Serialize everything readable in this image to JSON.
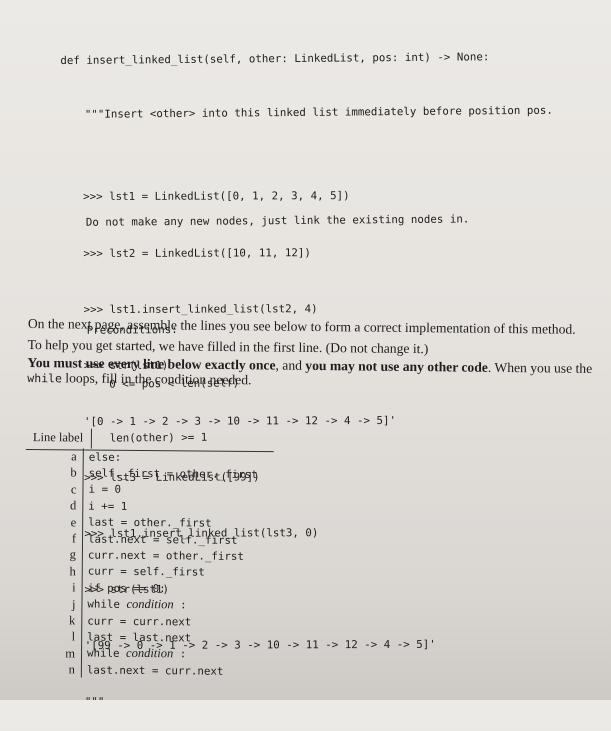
{
  "signature": {
    "def_line": "def insert_linked_list(self, other: LinkedList, pos: int) -> None:",
    "docstring_first": "\"\"\"Insert <other> into this linked list immediately before position pos.",
    "docstring_note": "Do not make any new nodes, just link the existing nodes in.",
    "preconditions_heading": "Preconditions:",
    "preconditions": [
      "0 <= pos < len(self)",
      "len(other) >= 1"
    ]
  },
  "doctest": [
    ">>> lst1 = LinkedList([0, 1, 2, 3, 4, 5])",
    ">>> lst2 = LinkedList([10, 11, 12])",
    ">>> lst1.insert_linked_list(lst2, 4)",
    ">>> str(lst1)",
    "'[0 -> 1 -> 2 -> 3 -> 10 -> 11 -> 12 -> 4 -> 5]'",
    ">>> lst3 = LinkedList([99])",
    ">>> lst1.insert_linked_list(lst3, 0)",
    ">>> str(lst1)",
    "'[99 -> 0 -> 1 -> 2 -> 3 -> 10 -> 11 -> 12 -> 4 -> 5]'",
    "\"\"\""
  ],
  "instructions": {
    "p1_line1": "On the next page, assemble the lines you see below to form a correct implementation of this method.",
    "p1_line2": "To help you get started, we have filled in the first line. (Do not change it.)",
    "p2_bold1": "You must use every line below exactly once",
    "p2_text1": ", and ",
    "p2_bold2": "you may not use any other code",
    "p2_text2": ". When you use the ",
    "p2_code": "while",
    "p2_text3": " loops, fill in the condition needed."
  },
  "table": {
    "header": "Line label",
    "rows": [
      {
        "label": "a",
        "code": "else:"
      },
      {
        "label": "b",
        "code": "self._first = other._first"
      },
      {
        "label": "c",
        "code": "i = 0"
      },
      {
        "label": "d",
        "code": "i += 1"
      },
      {
        "label": "e",
        "code": "last = other._first"
      },
      {
        "label": "f",
        "code": "last.next = self._first"
      },
      {
        "label": "g",
        "code": "curr.next = other._first"
      },
      {
        "label": "h",
        "code": "curr = self._first"
      },
      {
        "label": "i",
        "code": "if pos == 0:"
      },
      {
        "label": "j",
        "code": "while ",
        "italic": "condition",
        "suffix": " :"
      },
      {
        "label": "k",
        "code": "curr = curr.next"
      },
      {
        "label": "l",
        "code": "last = last.next"
      },
      {
        "label": "m",
        "code": "while ",
        "italic": "condition",
        "suffix": " :"
      },
      {
        "label": "n",
        "code": "last.next = curr.next"
      }
    ]
  }
}
